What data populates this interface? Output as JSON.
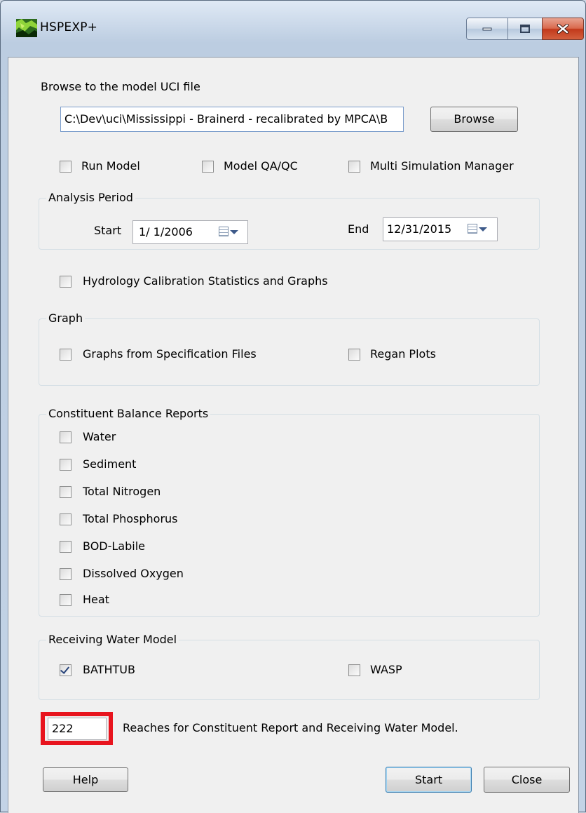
{
  "window": {
    "title": "HSPEXP+"
  },
  "uci": {
    "label": "Browse to the model UCI file",
    "path": "C:\\Dev\\uci\\Mississippi - Brainerd - recalibrated by MPCA\\B",
    "browse_label": "Browse"
  },
  "options": {
    "run_model": "Run Model",
    "model_qaqc": "Model QA/QC",
    "multi_sim": "Multi Simulation Manager"
  },
  "analysis_period": {
    "title": "Analysis Period",
    "start_label": "Start",
    "start_date": "1/ 1/2006",
    "end_label": "End",
    "end_date": "12/31/2015"
  },
  "hydrology": {
    "label": "Hydrology Calibration Statistics and Graphs"
  },
  "graph": {
    "title": "Graph",
    "spec_files": "Graphs from Specification Files",
    "regan": "Regan Plots"
  },
  "constituent": {
    "title": "Constituent Balance Reports",
    "items": [
      "Water",
      "Sediment",
      "Total Nitrogen",
      "Total Phosphorus",
      "BOD-Labile",
      "Dissolved Oxygen",
      "Heat"
    ]
  },
  "receiving": {
    "title": "Receiving Water Model",
    "bathtub": "BATHTUB",
    "bathtub_checked": true,
    "wasp": "WASP"
  },
  "reaches": {
    "value": "222",
    "label": "Reaches for Constituent Report and Receiving Water Model."
  },
  "buttons": {
    "help": "Help",
    "start": "Start",
    "close": "Close"
  },
  "colors": {
    "highlight": "#e8141e",
    "close_button": "#c2391b"
  }
}
